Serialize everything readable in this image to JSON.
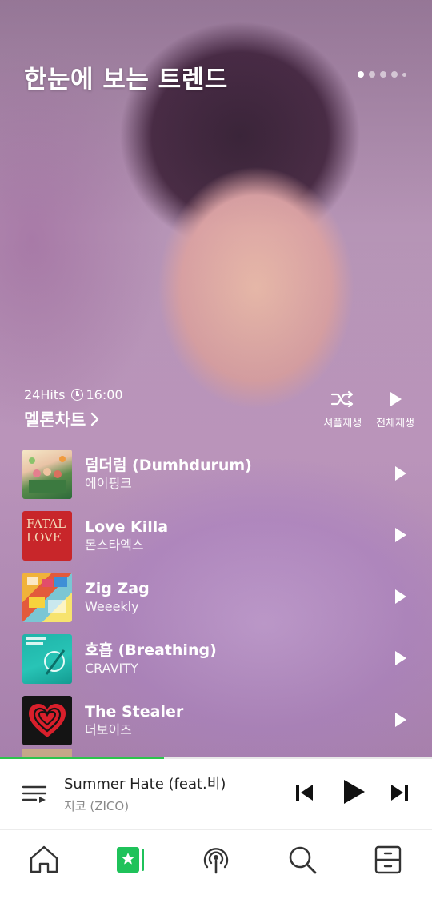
{
  "hero": {
    "title": "한눈에 보는 트렌드",
    "dots": 5,
    "active_dot": 0
  },
  "chart": {
    "badge": "24Hits",
    "time": "16:00",
    "title": "멜론차트",
    "shuffle_label": "셔플재생",
    "play_all_label": "전체재생",
    "songs": [
      {
        "title": "덤더럼 (Dumhdurum)",
        "artist": "에이핑크",
        "art_icon": "album-art-dumhdurum"
      },
      {
        "title": "Love Killa",
        "artist": "몬스타엑스",
        "art_text": "FATAL LOVE",
        "art_icon": "album-art-fatal-love"
      },
      {
        "title": "Zig Zag",
        "artist": "Weeekly",
        "art_icon": "album-art-weeekly"
      },
      {
        "title": "호흡 (Breathing)",
        "artist": "CRAVITY",
        "art_icon": "album-art-cravity"
      },
      {
        "title": "The Stealer",
        "artist": "더보이즈",
        "art_icon": "album-art-heart"
      }
    ]
  },
  "player": {
    "title": "Summer Hate (feat.비)",
    "artist": "지코 (ZICO)",
    "progress": 0.38
  },
  "nav": {
    "items": [
      "home",
      "my-music",
      "podcast",
      "search",
      "menu"
    ],
    "active": "my-music"
  },
  "colors": {
    "accent": "#2cc44c",
    "text_dark": "#222222",
    "text_muted": "#8a8a8a",
    "icon": "#333333"
  }
}
